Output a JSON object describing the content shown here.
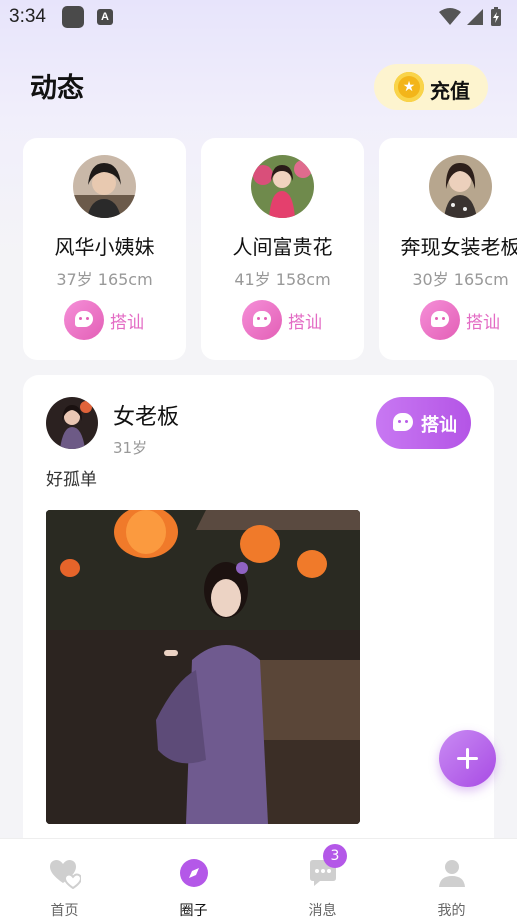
{
  "status_bar": {
    "time": "3:34",
    "notification_letter": "A"
  },
  "header": {
    "title": "动态",
    "recharge_label": "充值"
  },
  "users": [
    {
      "name": "风华小姨妹",
      "info": "37岁 165cm",
      "chat_label": "搭讪"
    },
    {
      "name": "人间富贵花",
      "info": "41岁 158cm",
      "chat_label": "搭讪"
    },
    {
      "name": "奔现女装老板",
      "info": "30岁 165cm",
      "chat_label": "搭讪"
    }
  ],
  "post": {
    "author": "女老板",
    "age": "31岁",
    "chat_label": "搭讪",
    "text": "好孤单"
  },
  "tabs": [
    {
      "label": "首页",
      "icon": "hearts-icon"
    },
    {
      "label": "圈子",
      "icon": "compass-icon"
    },
    {
      "label": "消息",
      "icon": "chat-icon"
    },
    {
      "label": "我的",
      "icon": "person-icon"
    }
  ],
  "messages_badge": "3",
  "colors": {
    "accent": "#b458e8",
    "chat_pink": "#e35fb6",
    "coin": "#f3b51a"
  }
}
